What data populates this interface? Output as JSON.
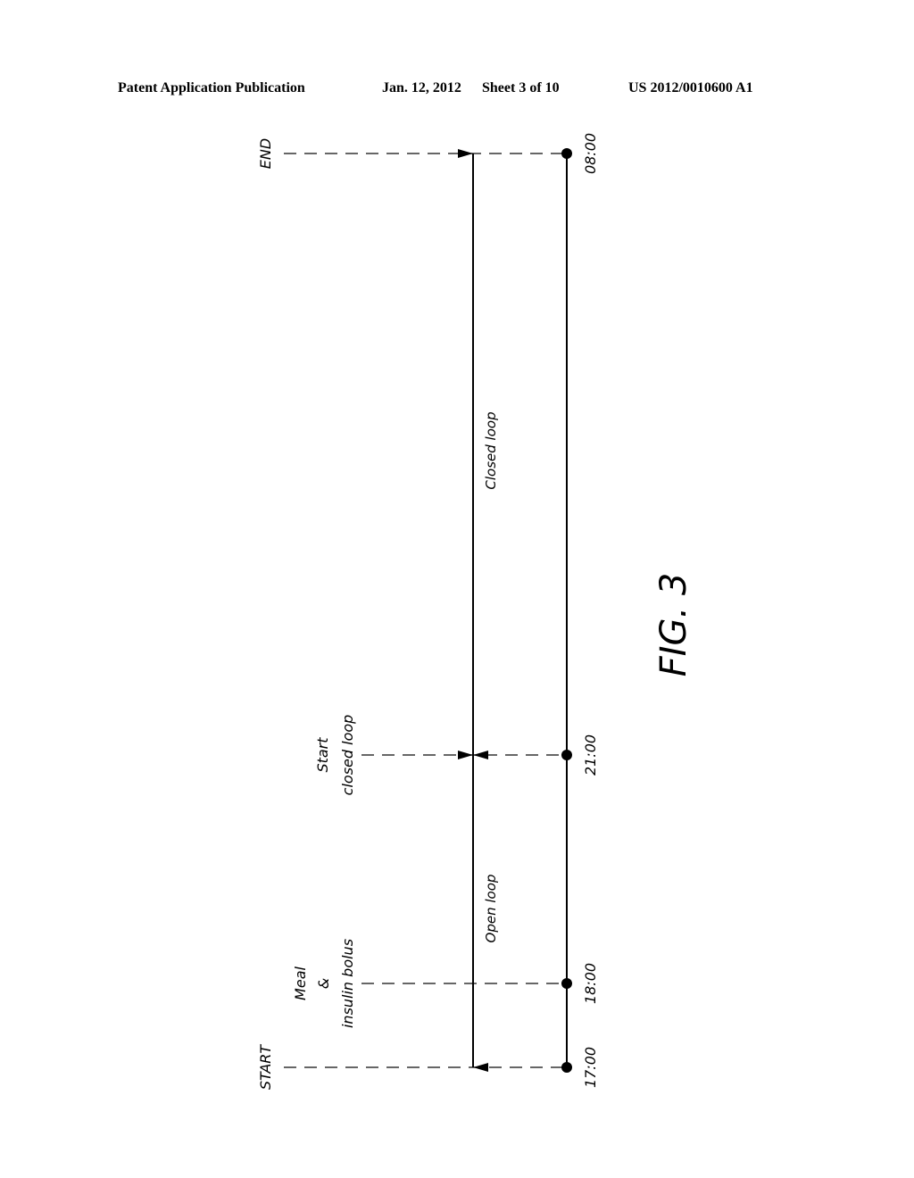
{
  "header": {
    "publication": "Patent Application Publication",
    "date": "Jan. 12, 2012",
    "sheet": "Sheet 3 of 10",
    "number": "US 2012/0010600 A1"
  },
  "figure": {
    "label": "FIG. 3",
    "events": [
      {
        "id": "start",
        "label_lines": [
          "START"
        ],
        "time": "17:00"
      },
      {
        "id": "meal",
        "label_lines": [
          "Meal",
          "&",
          "insulin bolus"
        ],
        "time": "18:00"
      },
      {
        "id": "start-closed",
        "label_lines": [
          "Start",
          "closed loop"
        ],
        "time": "21:00"
      },
      {
        "id": "end",
        "label_lines": [
          "END"
        ],
        "time": "08:00"
      }
    ],
    "phases": [
      {
        "id": "open-loop",
        "label": "Open loop",
        "from": "17:00",
        "to": "21:00"
      },
      {
        "id": "closed-loop",
        "label": "Closed loop",
        "from": "21:00",
        "to": "08:00"
      }
    ]
  }
}
